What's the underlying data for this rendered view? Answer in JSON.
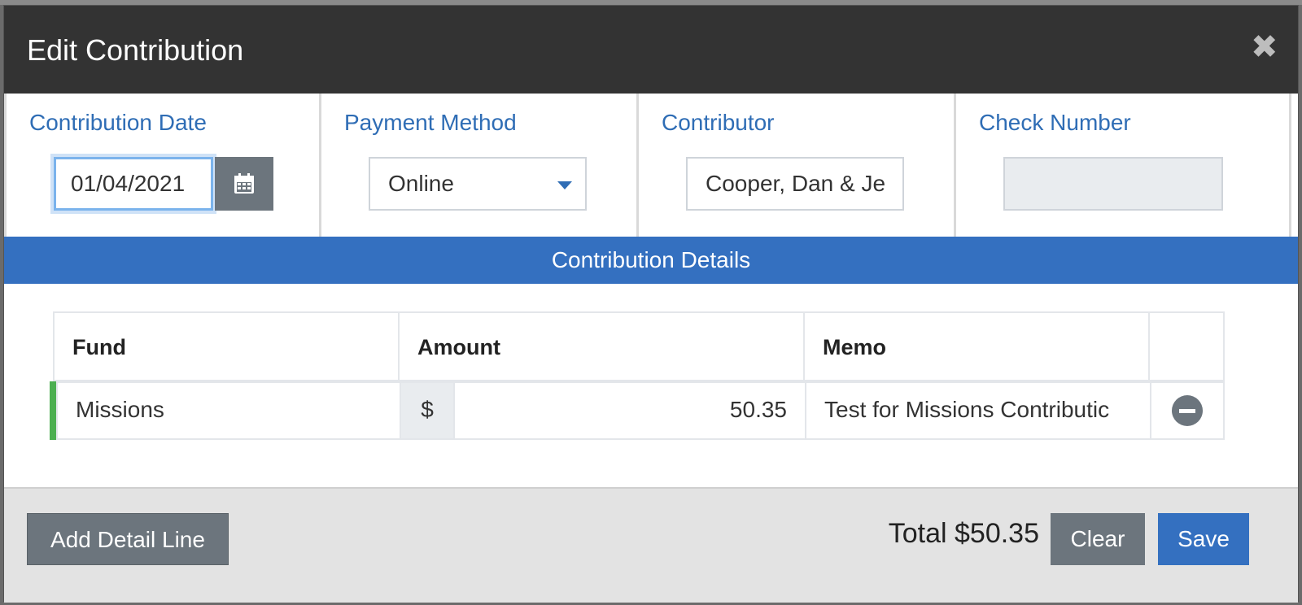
{
  "dialog": {
    "title": "Edit Contribution",
    "close_symbol": "✖"
  },
  "fields": {
    "date_label": "Contribution Date",
    "date_value": "01/04/2021",
    "payment_label": "Payment Method",
    "payment_value": "Online",
    "contributor_label": "Contributor",
    "contributor_value": "Cooper, Dan & Je",
    "check_label": "Check Number",
    "check_value": ""
  },
  "details": {
    "header": "Contribution Details",
    "columns": [
      "Fund",
      "Amount",
      "Memo",
      ""
    ],
    "rows": [
      {
        "fund": "Missions",
        "currency": "$",
        "amount": "50.35",
        "memo": "Test for Missions Contributic"
      }
    ]
  },
  "footer": {
    "add_line_label": "Add Detail Line",
    "total_label": "Total $50.35",
    "clear_label": "Clear",
    "save_label": "Save"
  },
  "colors": {
    "header_bg": "#333333",
    "accent_blue": "#3470c0",
    "label_blue": "#2f6db5",
    "button_gray": "#6c757d",
    "row_accent": "#4caf50"
  },
  "icons": {
    "calendar": "calendar-icon",
    "dropdown": "chevron-down-icon",
    "close": "close-icon",
    "remove": "minus-circle-icon"
  }
}
